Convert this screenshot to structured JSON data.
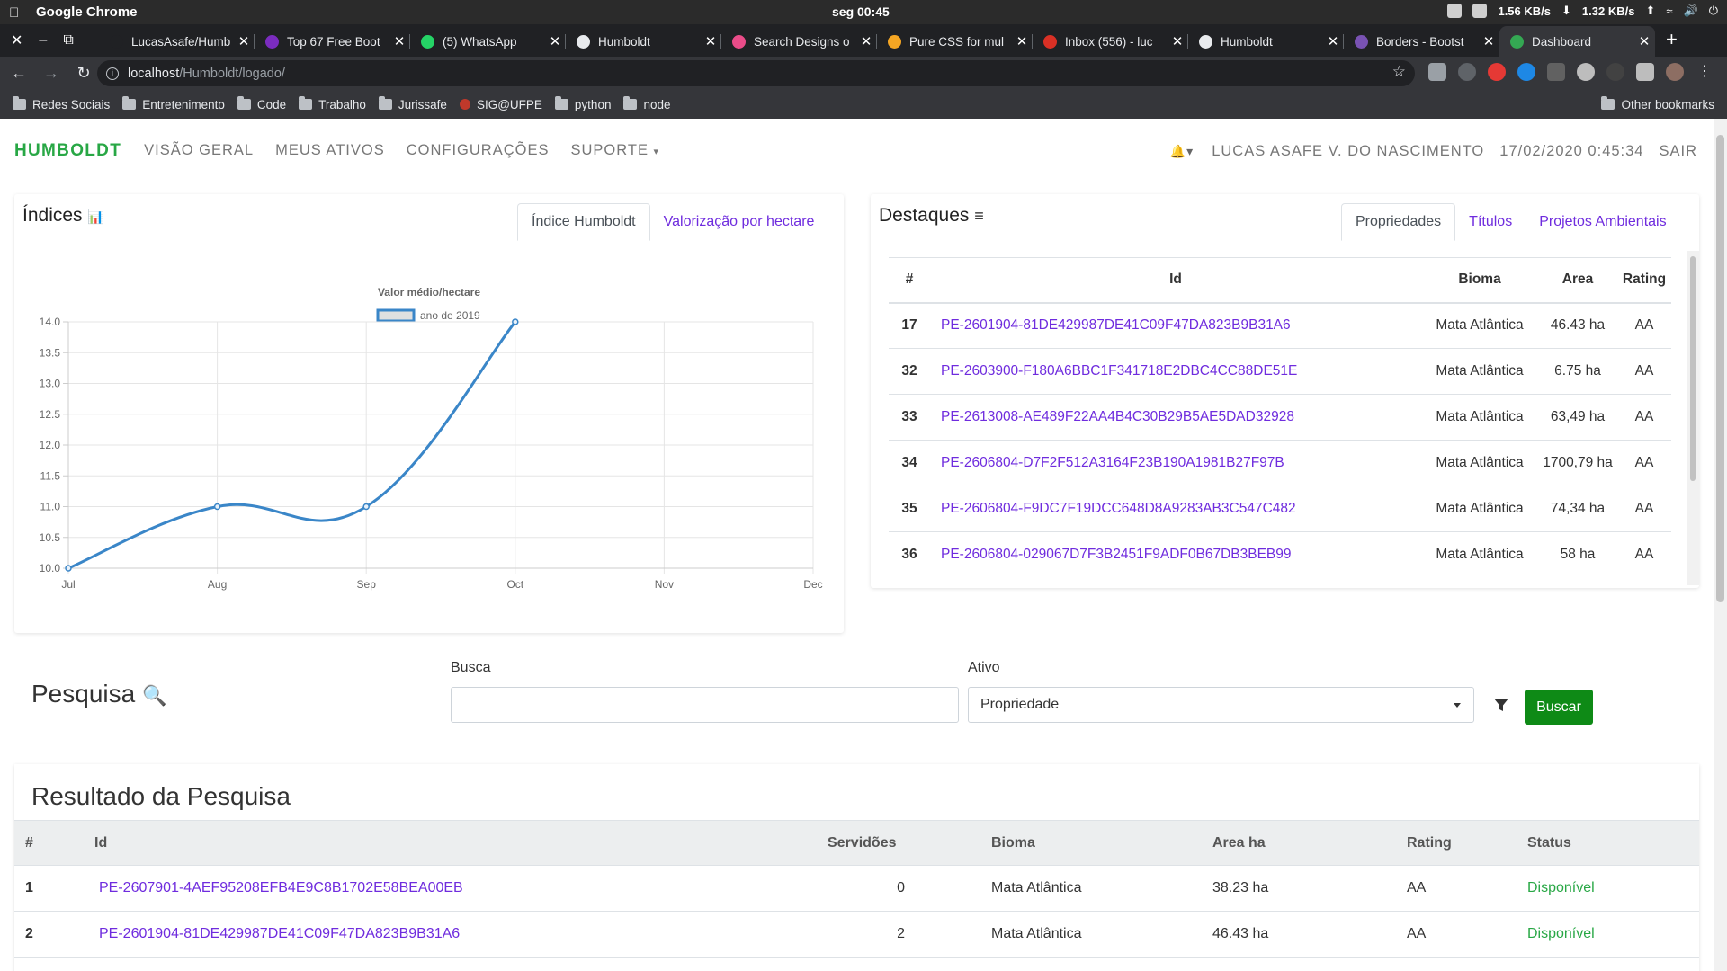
{
  "os": {
    "app_name": "Google Chrome",
    "clock": "seg 00:45",
    "net_down": "1.56 KB/s",
    "net_up": "1.32 KB/s"
  },
  "browser": {
    "tabs": [
      {
        "label": "LucasAsafe/Humb",
        "color": "#202124"
      },
      {
        "label": "Top 67 Free Boot",
        "color": "#7b2cbf"
      },
      {
        "label": "(5) WhatsApp",
        "color": "#25d366"
      },
      {
        "label": "Humboldt",
        "color": "#e8eaed"
      },
      {
        "label": "Search Designs o",
        "color": "#ea4c89"
      },
      {
        "label": "Pure CSS for mul",
        "color": "#f5a623"
      },
      {
        "label": "Inbox (556) - luc",
        "color": "#d93025"
      },
      {
        "label": "Humboldt",
        "color": "#e8eaed"
      },
      {
        "label": "Borders - Bootst",
        "color": "#7952b3"
      },
      {
        "label": "Dashboard",
        "color": "#34a853"
      }
    ],
    "url_host": "localhost",
    "url_path": "/Humboldt/logado/",
    "bookmarks": [
      "Redes Sociais",
      "Entretenimento",
      "Code",
      "Trabalho",
      "Jurissafe",
      "SIG@UFPE",
      "python",
      "node"
    ],
    "other_bookmarks": "Other bookmarks"
  },
  "navbar": {
    "brand": "HUMBOLDT",
    "items": [
      "VISÃO GERAL",
      "MEUS ATIVOS",
      "CONFIGURAÇÕES",
      "SUPORTE"
    ],
    "user": "LUCAS ASAFE V. DO NASCIMENTO",
    "datetime": "17/02/2020 0:45:34",
    "logout": "SAIR"
  },
  "indices": {
    "title": "Índices",
    "tabs": [
      "Índice Humboldt",
      "Valorização por hectare"
    ],
    "active_tab": 0
  },
  "chart_data": {
    "type": "line",
    "title": "Valor médio/hectare",
    "categories": [
      "Jul",
      "Aug",
      "Sep",
      "Oct",
      "Nov",
      "Dec"
    ],
    "series": [
      {
        "name": "ano de 2019",
        "values": [
          10.0,
          11.0,
          11.0,
          14.0,
          null,
          null
        ],
        "color": "#3a86c8"
      }
    ],
    "ylim": [
      10.0,
      14.0
    ],
    "yticks": [
      "10.0",
      "10.5",
      "11.0",
      "11.5",
      "12.0",
      "12.5",
      "13.0",
      "13.5",
      "14.0"
    ],
    "grid": true,
    "legend": "top"
  },
  "destaques": {
    "title": "Destaques",
    "tabs": [
      "Propriedades",
      "Títulos",
      "Projetos Ambientais"
    ],
    "active_tab": 0,
    "columns": [
      "#",
      "Id",
      "Bioma",
      "Area",
      "Rating"
    ],
    "rows": [
      {
        "n": "17",
        "id": "PE-2601904-81DE429987DE41C09F47DA823B9B31A6",
        "bioma": "Mata Atlântica",
        "area": "46.43 ha",
        "rating": "AA"
      },
      {
        "n": "32",
        "id": "PE-2603900-F180A6BBC1F341718E2DBC4CC88DE51E",
        "bioma": "Mata Atlântica",
        "area": "6.75 ha",
        "rating": "AA"
      },
      {
        "n": "33",
        "id": "PE-2613008-AE489F22AA4B4C30B29B5AE5DAD32928",
        "bioma": "Mata Atlântica",
        "area": "63,49 ha",
        "rating": "AA"
      },
      {
        "n": "34",
        "id": "PE-2606804-D7F2F512A3164F23B190A1981B27F97B",
        "bioma": "Mata Atlântica",
        "area": "1700,79 ha",
        "rating": "AA"
      },
      {
        "n": "35",
        "id": "PE-2606804-F9DC7F19DCC648D8A9283AB3C547C482",
        "bioma": "Mata Atlântica",
        "area": "74,34 ha",
        "rating": "AA"
      },
      {
        "n": "36",
        "id": "PE-2606804-029067D7F3B2451F9ADF0B67DB3BEB99",
        "bioma": "Mata Atlântica",
        "area": "58 ha",
        "rating": "AA"
      }
    ]
  },
  "pesquisa": {
    "title": "Pesquisa",
    "busca_label": "Busca",
    "busca_value": "",
    "ativo_label": "Ativo",
    "ativo_value": "Propriedade",
    "button": "Buscar"
  },
  "resultado": {
    "title": "Resultado da Pesquisa",
    "columns": [
      "#",
      "Id",
      "Servidões",
      "Bioma",
      "Area ha",
      "Rating",
      "Status"
    ],
    "rows": [
      {
        "n": "1",
        "id": "PE-2607901-4AEF95208EFB4E9C8B1702E58BEA00EB",
        "servidoes": "0",
        "bioma": "Mata Atlântica",
        "area": "38.23 ha",
        "rating": "AA",
        "status": "Disponível"
      },
      {
        "n": "2",
        "id": "PE-2601904-81DE429987DE41C09F47DA823B9B31A6",
        "servidoes": "2",
        "bioma": "Mata Atlântica",
        "area": "46.43 ha",
        "rating": "AA",
        "status": "Disponível"
      }
    ]
  },
  "colors": {
    "brand": "#28a745",
    "link": "#6f2cde",
    "button": "#0e8a16",
    "status_ok": "#28a745"
  }
}
